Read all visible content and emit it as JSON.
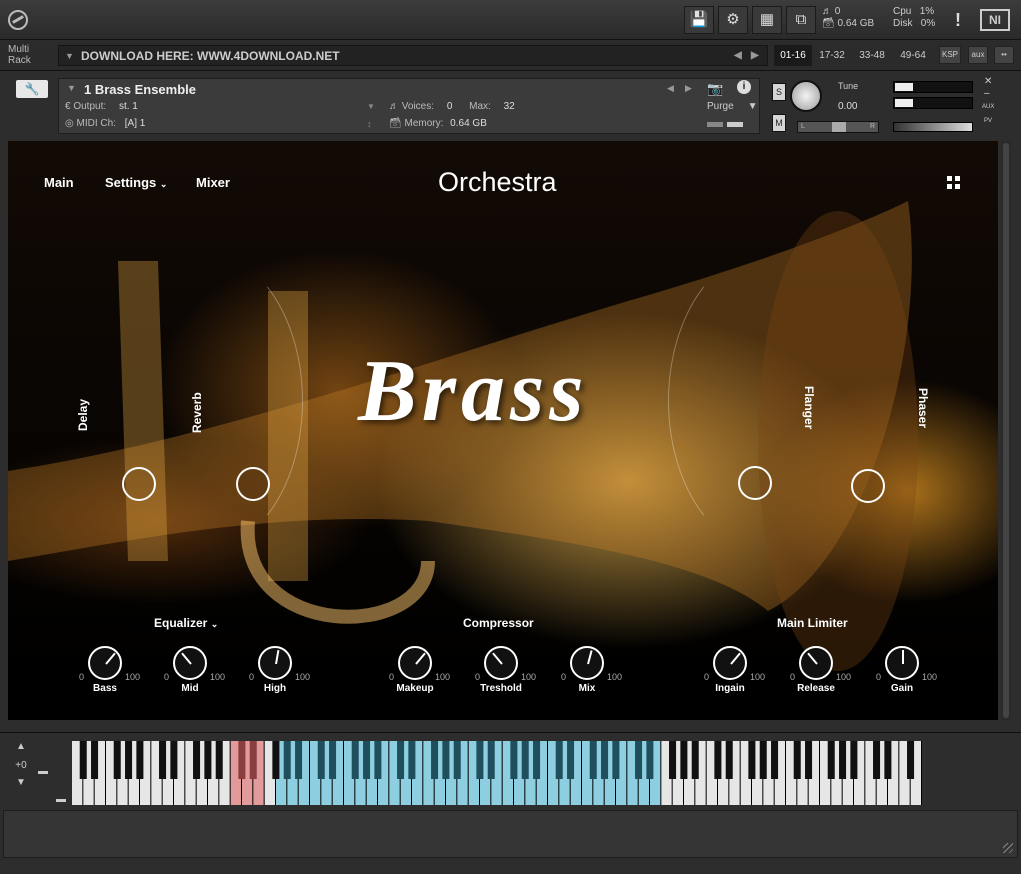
{
  "toolbar": {
    "stats_left_top": "0",
    "stats_left_bottom": "0.64 GB",
    "cpu_label": "Cpu",
    "cpu_value": "1%",
    "disk_label": "Disk",
    "disk_value": "0%",
    "warning": "!",
    "ni_logo": "NI"
  },
  "rack": {
    "label": "Multi Rack",
    "download_text": "DOWNLOAD HERE: WWW.4DOWNLOAD.NET",
    "pages": [
      "01-16",
      "17-32",
      "33-48",
      "49-64"
    ],
    "ksp": "KSP",
    "aux": "aux"
  },
  "instrument": {
    "name": "1 Brass Ensemble",
    "output_label": "Output:",
    "output_value": "st. 1",
    "voices_label": "Voices:",
    "voices_value": "0",
    "max_label": "Max:",
    "max_value": "32",
    "midi_label": "MIDI Ch:",
    "midi_value": "[A]  1",
    "memory_label": "Memory:",
    "memory_value": "0.64 GB",
    "purge": "Purge",
    "solo": "S",
    "mute": "M",
    "tune_label": "Tune",
    "tune_value": "0.00",
    "pan_left": "L",
    "pan_right": "R",
    "aux": "AUX",
    "pv": "PV"
  },
  "panel": {
    "nav": [
      "Main",
      "Settings",
      "Mixer"
    ],
    "title": "Orchestra",
    "brand": "Brass",
    "fx": {
      "delay": "Delay",
      "reverb": "Reverb",
      "flanger": "Flanger",
      "phaser": "Phaser"
    },
    "sections": {
      "eq": "Equalizer",
      "comp": "Compressor",
      "limiter": "Main Limiter"
    },
    "knobs": [
      {
        "label": "Bass",
        "min": "0",
        "max": "100"
      },
      {
        "label": "Mid",
        "min": "0",
        "max": "100"
      },
      {
        "label": "High",
        "min": "0",
        "max": "100"
      },
      {
        "label": "Makeup",
        "min": "0",
        "max": "100"
      },
      {
        "label": "Treshold",
        "min": "0",
        "max": "100"
      },
      {
        "label": "Mix",
        "min": "0",
        "max": "100"
      },
      {
        "label": "Ingain",
        "min": "0",
        "max": "100"
      },
      {
        "label": "Release",
        "min": "0",
        "max": "100"
      },
      {
        "label": "Gain",
        "min": "0",
        "max": "100"
      }
    ]
  },
  "keyboard": {
    "octave": "+0"
  }
}
